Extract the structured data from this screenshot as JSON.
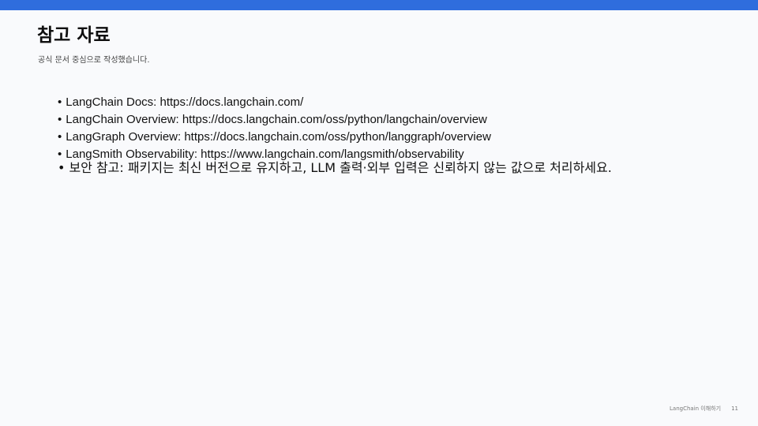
{
  "colors": {
    "top_bar": "#2f6ddd",
    "background": "#f9fafc"
  },
  "title": "참고 자료",
  "subtitle": "공식 문서 중심으로 작성했습니다.",
  "bullet_icon": "bullet-dot-icon",
  "bullet_glyph": "•",
  "references": [
    "LangChain Docs: https://docs.langchain.com/",
    "LangChain Overview: https://docs.langchain.com/oss/python/langchain/overview",
    "LangGraph Overview: https://docs.langchain.com/oss/python/langgraph/overview",
    "LangSmith Observability: https://www.langchain.com/langsmith/observability",
    "보안 참고: 패키지는 최신 버전으로 유지하고, LLM 출력·외부 입력은 신뢰하지 않는 값으로 처리하세요."
  ],
  "footer": {
    "label": "LangChain 이해하기",
    "page": "11"
  }
}
